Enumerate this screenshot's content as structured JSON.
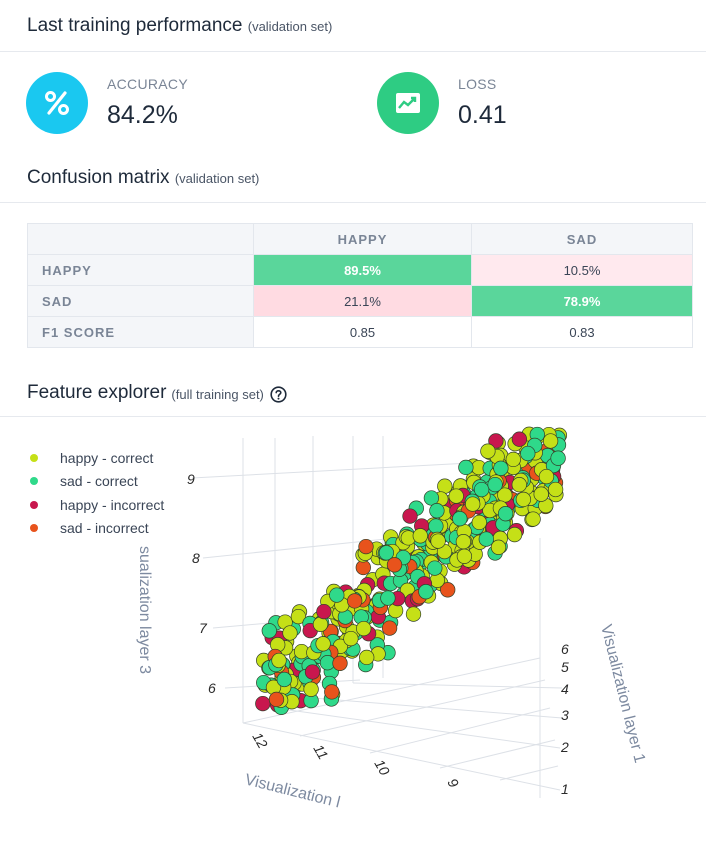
{
  "performance": {
    "title": "Last training performance",
    "subtitle": "(validation set)",
    "accuracy_label": "ACCURACY",
    "accuracy_value": "84.2%",
    "loss_label": "LOSS",
    "loss_value": "0.41",
    "accuracy_icon": "percent-icon",
    "loss_icon": "trend-chart-icon",
    "accuracy_color": "#1ac8f0",
    "loss_color": "#2ecc83"
  },
  "confusion": {
    "title": "Confusion matrix",
    "subtitle": "(validation set)",
    "col_headers": [
      "HAPPY",
      "SAD"
    ],
    "rows": [
      {
        "label": "HAPPY",
        "cells": [
          "89.5%",
          "10.5%"
        ]
      },
      {
        "label": "SAD",
        "cells": [
          "21.1%",
          "78.9%"
        ]
      },
      {
        "label": "F1 SCORE",
        "cells": [
          "0.85",
          "0.83"
        ]
      }
    ]
  },
  "explorer": {
    "title": "Feature explorer",
    "subtitle": "(full training set)",
    "help_icon": "help-circle-icon",
    "legend": [
      {
        "name": "happy - correct",
        "color": "#c5e017"
      },
      {
        "name": "sad - correct",
        "color": "#2fd98a"
      },
      {
        "name": "happy - incorrect",
        "color": "#c8174e"
      },
      {
        "name": "sad - incorrect",
        "color": "#e8531c"
      }
    ],
    "axis_layer3": "sualization layer 3",
    "axis_layer1": "Visualization layer 1",
    "axis_layer2": "Visualization l",
    "ticks_layer3": [
      "9",
      "8",
      "7",
      "6"
    ],
    "ticks_layer1": [
      "6",
      "5",
      "4",
      "3",
      "2",
      "1"
    ],
    "ticks_layer2": [
      "12",
      "11",
      "10",
      "9"
    ]
  }
}
